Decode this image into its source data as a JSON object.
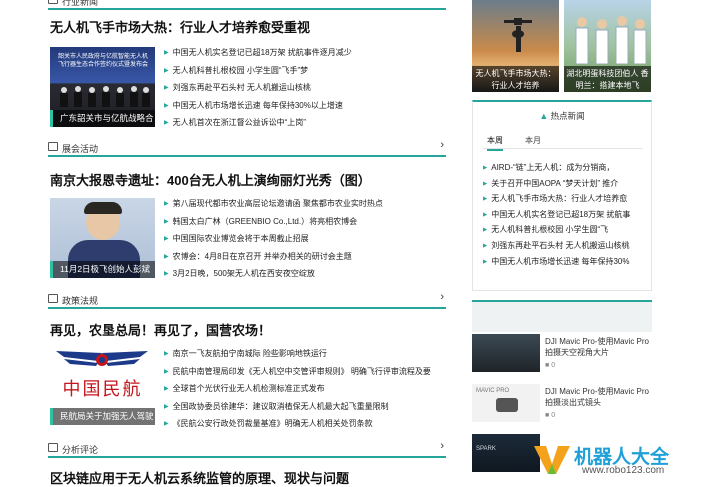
{
  "sections": {
    "industry": {
      "label": "行业新闻"
    },
    "exhibition": {
      "label": "展会活动"
    },
    "policy": {
      "label": "政策法规"
    },
    "analysis": {
      "label": "分析评论"
    }
  },
  "industry": {
    "headline": "无人机飞手市场大热：行业人才培养愈受重视",
    "thumb_caption": "广东韶关市与亿航战略合",
    "thumb_banner_text": "韶关市人民政府与亿航智能无人机飞行器生态合作签约仪式暨发布会",
    "items": [
      "中国无人机实名登记已超18万架 扰航事件逐月减少",
      "无人机科普扎根校园 小学生圆“飞手”梦",
      "刘强东再赴平石头村 无人机搬运山核桃",
      "中国无人机市场增长迅速 每年保持30%以上增速",
      "无人机首次在浙江督公益诉讼中“上岗”"
    ]
  },
  "exhibition": {
    "headline": "南京大报恩寺遗址：400台无人机上演绚丽灯光秀（图）",
    "thumb_caption": "11月2日极飞创始人彭斌",
    "items": [
      "第八届现代都市农业高层论坛邀请函 聚焦都市农业实时热点",
      "韩国太白广林（GREENBIO Co.,Ltd.）将亮相农博会",
      "中国国际农业博览会将于本周截止招展",
      "农博会：4月8日在京召开 并举办相关的研讨会主题",
      "3月2日晚，500架无人机在西安夜空绽放"
    ]
  },
  "policy": {
    "headline": "再见，农垦总局！再见了，国营农场！",
    "thumb_caption": "民航局关于加强无人驾驶",
    "logo_text": "中国民航",
    "items": [
      "南京一飞友航拍宁南城际 险些影响地铁运行",
      "民航中南管理局印发《无人机空中交管评审规则》 明确飞行评审流程及要",
      "全球首个光伏行业无人机检测标准正式发布",
      "全国政协委员徐建华：建议取消植保无人机最大起飞重量限制",
      "《民航公安行政处罚裁量基准》明确无人机相关处罚条款"
    ]
  },
  "analysis": {
    "headline": "区块链应用于无人机云系统监管的原理、现状与问题"
  },
  "top_thumbs": [
    {
      "caption": "无人机飞手市场大热：行业人才培养"
    },
    {
      "caption": "湖北明蛋科技团伯人 香明兰：搭建本地飞"
    }
  ],
  "hot": {
    "title": "热点新闻",
    "tabs": [
      "本周",
      "本月"
    ],
    "active_tab": "本周",
    "items": [
      "AIRD-“链”上无人机：成为分销商，",
      "关于召开中国AOPA “梦天计划” 推介",
      "无人机飞手市场大热：行业人才培养愈",
      "中国无人机实名登记已超18万架 扰航事",
      "无人机科普扎根校园 小学生圆“飞",
      "刘强东再赴平石头村 无人机搬运山核桃",
      "中国无人机市场增长迅速 每年保持30%"
    ]
  },
  "videos": [
    {
      "title": "DJI Mavic Pro-使用Mavic Pro拍摄天空视角大片",
      "meta": "0",
      "thumb_text": ""
    },
    {
      "title": "DJI Mavic Pro-使用Mavic Pro拍摄淡出式镜头",
      "meta": "0",
      "thumb_text": "MAVIC PRO"
    },
    {
      "title": "",
      "meta": "",
      "thumb_text": "SPARK"
    }
  ],
  "watermark": {
    "brand": "机器人大全",
    "url": "www.robo123.com"
  },
  "colors": {
    "accent": "#26a69a",
    "hot_accent": "#26a69a"
  }
}
